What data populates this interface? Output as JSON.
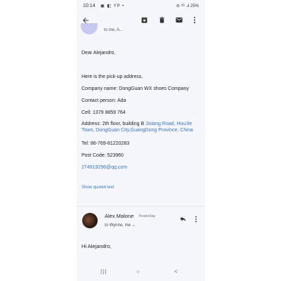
{
  "status": {
    "time": "10:14",
    "icons": "▣ ◧ YP •",
    "right": "⊘ ⁵ᴳ .ıl 25%"
  },
  "toolbar": {
    "back_icon": "back-arrow-icon",
    "archive_icon": "archive-icon",
    "delete_icon": "trash-icon",
    "mark_unread_icon": "mail-icon",
    "more_icon": "more-vert-icon"
  },
  "message1": {
    "sender_fragment": "to me, A...",
    "greeting": "Dear Alejandro,",
    "intro": "Here is the pick-up address.",
    "company": "Company name: DongGuan WX shoes Company",
    "contact": "Contact person: Ada",
    "cell": "Cell: 1379 8859 764",
    "address_prefix": "Address: 2th floor, building B ",
    "address_link": "Jixiang Road, HouJie Town, DongGuan City,GuangDong Province, China",
    "tel": "Tel: 86-769-81220283",
    "post": "Post Code: 523960",
    "email": "274919296@qq.com",
    "show_quoted": "Show quoted text"
  },
  "message2": {
    "name": "Alex Malone",
    "when": "Yesterday",
    "to": "to Wynne, me",
    "greeting": "Hi Alejandro,"
  },
  "navbar": {
    "recent": "|||",
    "home": "○",
    "back": "<"
  }
}
